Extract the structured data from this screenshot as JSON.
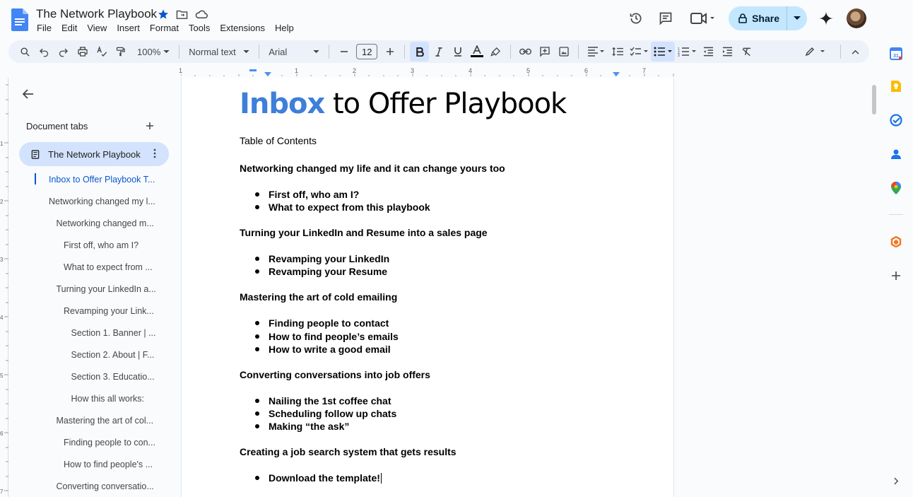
{
  "doc": {
    "title": "The Network Playbook"
  },
  "menu": [
    "File",
    "Edit",
    "View",
    "Insert",
    "Format",
    "Tools",
    "Extensions",
    "Help"
  ],
  "header": {
    "share_label": "Share"
  },
  "toolbar": {
    "zoom": "100%",
    "style": "Normal text",
    "font": "Arial",
    "font_size": "12"
  },
  "ruler": {
    "numbers": [
      "1",
      "1",
      "2",
      "3",
      "4",
      "5",
      "6",
      "7"
    ],
    "vnumbers": [
      "1",
      "2",
      "3",
      "4",
      "5",
      "6",
      "7"
    ]
  },
  "sidebar": {
    "tabs_label": "Document tabs",
    "active_tab": "The Network Playbook",
    "outline": [
      {
        "label": "Inbox to Offer Playbook T...",
        "level": 0,
        "selected": true
      },
      {
        "label": "Networking changed my l...",
        "level": 0
      },
      {
        "label": "Networking changed m...",
        "level": 1
      },
      {
        "label": "First off, who am I?",
        "level": 2
      },
      {
        "label": "What to expect from ...",
        "level": 2
      },
      {
        "label": "Turning your LinkedIn a...",
        "level": 1
      },
      {
        "label": "Revamping your Link...",
        "level": 2
      },
      {
        "label": "Section 1. Banner | ...",
        "level": 3
      },
      {
        "label": "Section 2. About | F...",
        "level": 3
      },
      {
        "label": "Section 3. Educatio...",
        "level": 3
      },
      {
        "label": "How this all works:",
        "level": 3
      },
      {
        "label": "Mastering the art of col...",
        "level": 1
      },
      {
        "label": "Finding people to con...",
        "level": 2
      },
      {
        "label": "How to find people's ...",
        "level": 2
      },
      {
        "label": "Converting conversatio...",
        "level": 1
      }
    ]
  },
  "document": {
    "title_highlight": "Inbox",
    "title_rest": " to Offer Playbook",
    "toc_label": "Table of Contents",
    "sections": [
      {
        "heading": "Networking changed my life and it can change yours too",
        "items": [
          "First off, who am I?",
          "What to expect from this playbook"
        ]
      },
      {
        "heading": "Turning your LinkedIn and Resume into a sales page",
        "items": [
          "Revamping your LinkedIn",
          "Revamping your Resume"
        ]
      },
      {
        "heading": "Mastering the art of cold emailing",
        "items": [
          "Finding people to contact",
          "How to find people’s emails",
          "How to write a good email"
        ]
      },
      {
        "heading": "Converting conversations into job offers",
        "items": [
          "Nailing the 1st coffee chat",
          "Scheduling follow up chats",
          "Making “the ask”"
        ]
      },
      {
        "heading": "Creating a job search system that gets results",
        "items": [
          "Download the template!"
        ]
      }
    ]
  },
  "colors": {
    "accent": "#0b57d0",
    "title_highlight": "#3d7fd9",
    "share_bg": "#c2e7ff",
    "toolbar_bg": "#edf2fa"
  }
}
